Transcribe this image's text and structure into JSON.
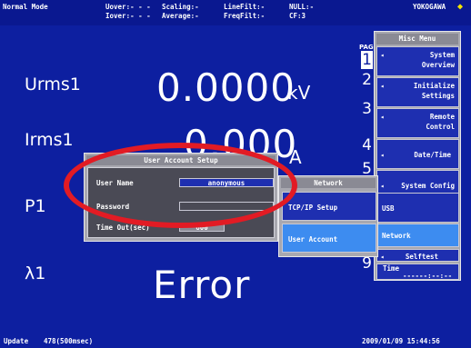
{
  "status": {
    "mode": "Normal Mode",
    "uover": "Uover:- - -",
    "iover": "Iover:- - -",
    "scaling": "Scaling:-",
    "averaging": "Average:-",
    "linefilt": "LineFilt:-",
    "freqfilt": "FreqFilt:-",
    "null": "NULL:-",
    "cf": "CF:3",
    "vendor": "YOKOGAWA"
  },
  "measurements": [
    {
      "label": "Urms1",
      "value": "0.0000",
      "unit": "kV"
    },
    {
      "label": "Irms1",
      "value": "0.000",
      "unit": "A"
    },
    {
      "label": "P1",
      "value": "",
      "unit": ""
    },
    {
      "label": "λ1",
      "value": "Error",
      "unit": ""
    }
  ],
  "page": {
    "label": "PAG",
    "numbers": [
      "1",
      "2",
      "3",
      "4",
      "5",
      "9"
    ]
  },
  "menu": {
    "title": "Misc Menu",
    "items": [
      {
        "line1": "System",
        "line2": "Overview"
      },
      {
        "line1": "Initialize",
        "line2": "Settings"
      },
      {
        "line1": "Remote",
        "line2": "Control"
      },
      {
        "line1": "Date/Time",
        "line2": ""
      },
      {
        "line1": "System Config",
        "line2": ""
      },
      {
        "line1": "USB",
        "line2": ""
      },
      {
        "line1": "Network",
        "line2": ""
      },
      {
        "line1": "Selftest",
        "line2": ""
      }
    ],
    "time_label": "Time",
    "time_value": "------:--:--"
  },
  "network": {
    "title": "Network",
    "tcpip": "TCP/IP Setup",
    "user_account": "User Account"
  },
  "dialog": {
    "title": "User Account Setup",
    "user_name_label": "User Name",
    "user_name_value": "anonymous",
    "password_label": "Password",
    "password_value": "",
    "timeout_label": "Time Out(sec)",
    "timeout_value": "600"
  },
  "footer": {
    "update": "Update",
    "update_count": "478(500msec)",
    "datetime": "2009/01/09 15:44:56"
  },
  "colors": {
    "background": "#0d1fa0",
    "highlight": "#3d8cf0",
    "annotation_ring": "#e21b24",
    "vendor_diamond": "#f3e400"
  }
}
